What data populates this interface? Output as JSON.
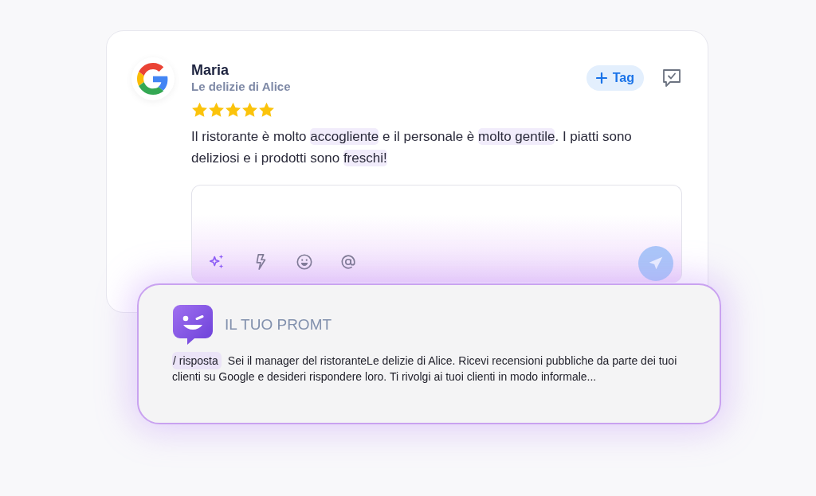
{
  "review": {
    "author": "Maria",
    "business": "Le delizie di Alice",
    "stars": 5,
    "tag_button": {
      "label": "Tag"
    },
    "text": [
      {
        "text": "Il ristorante è molto ",
        "highlight": false
      },
      {
        "text": "accogliente",
        "highlight": true
      },
      {
        "text": " e il personale è ",
        "highlight": false
      },
      {
        "text": "molto gentile",
        "highlight": true
      },
      {
        "text": ". I piatti sono deliziosi e i prodotti sono ",
        "highlight": false
      },
      {
        "text": "freschi!",
        "highlight": true
      }
    ]
  },
  "prompt": {
    "title": "IL TUO PROMT",
    "command": "/ risposta",
    "text": "Sei il manager del ristoranteLe delizie di Alice. Ricevi recensioni pubbliche da parte dei tuoi clienti su Google e desideri rispondere loro. Ti rivolgi ai tuoi clienti in modo informale..."
  }
}
